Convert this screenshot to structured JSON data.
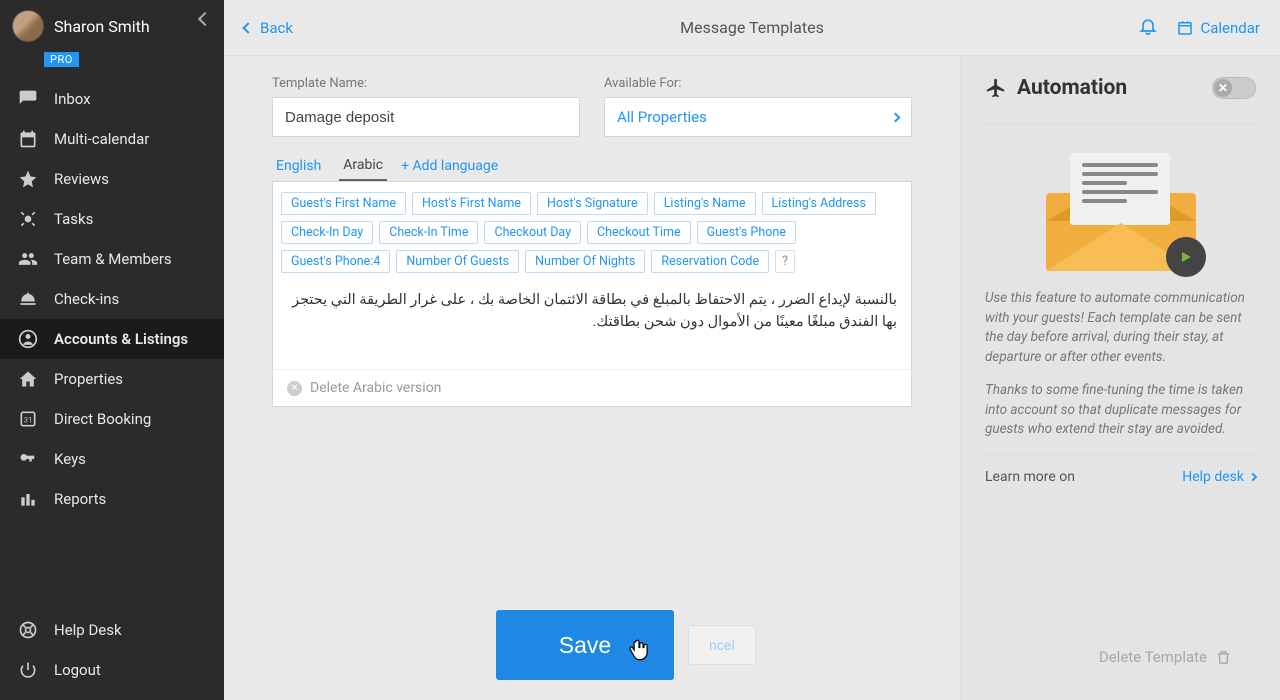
{
  "user": {
    "name": "Sharon Smith",
    "badge": "PRO"
  },
  "sidebar": {
    "items": [
      {
        "label": "Inbox"
      },
      {
        "label": "Multi-calendar"
      },
      {
        "label": "Reviews"
      },
      {
        "label": "Tasks"
      },
      {
        "label": "Team & Members"
      },
      {
        "label": "Check-ins"
      },
      {
        "label": "Accounts & Listings"
      },
      {
        "label": "Properties"
      },
      {
        "label": "Direct Booking"
      },
      {
        "label": "Keys"
      },
      {
        "label": "Reports"
      }
    ],
    "bottom": [
      {
        "label": "Help Desk"
      },
      {
        "label": "Logout"
      }
    ]
  },
  "header": {
    "back": "Back",
    "title": "Message Templates",
    "calendar": "Calendar"
  },
  "form": {
    "template_name_label": "Template Name:",
    "template_name_value": "Damage deposit",
    "available_for_label": "Available For:",
    "available_for_value": "All Properties",
    "lang_english": "English",
    "lang_arabic": "Arabic",
    "add_language": "+ Add language",
    "tokens": [
      "Guest's First Name",
      "Host's First Name",
      "Host's Signature",
      "Listing's Name",
      "Listing's Address",
      "Check-In Day",
      "Check-In Time",
      "Checkout Day",
      "Checkout Time",
      "Guest's Phone",
      "Guest's Phone:4",
      "Number Of Guests",
      "Number Of Nights",
      "Reservation Code"
    ],
    "token_help": "?",
    "body_text": "بالنسبة لإيداع الضرر ، يتم الاحتفاظ بالمبلغ في بطاقة الائتمان الخاصة بك ، على غرار الطريقة التي يحتجز بها الفندق مبلغًا معينًا من الأموال دون شحن بطاقتك.",
    "delete_version": "Delete Arabic version"
  },
  "footer": {
    "save": "Save",
    "cancel": "ncel",
    "delete_template": "Delete Template"
  },
  "automation": {
    "title": "Automation",
    "p1": "Use this feature to automate communication with your guests! Each template can be sent the day before arrival, during their stay, at departure or after other events.",
    "p2": "Thanks to some fine-tuning the time is taken into account so that duplicate messages for guests who extend their stay are avoided.",
    "learn_label": "Learn more on",
    "helpdesk": "Help desk"
  }
}
